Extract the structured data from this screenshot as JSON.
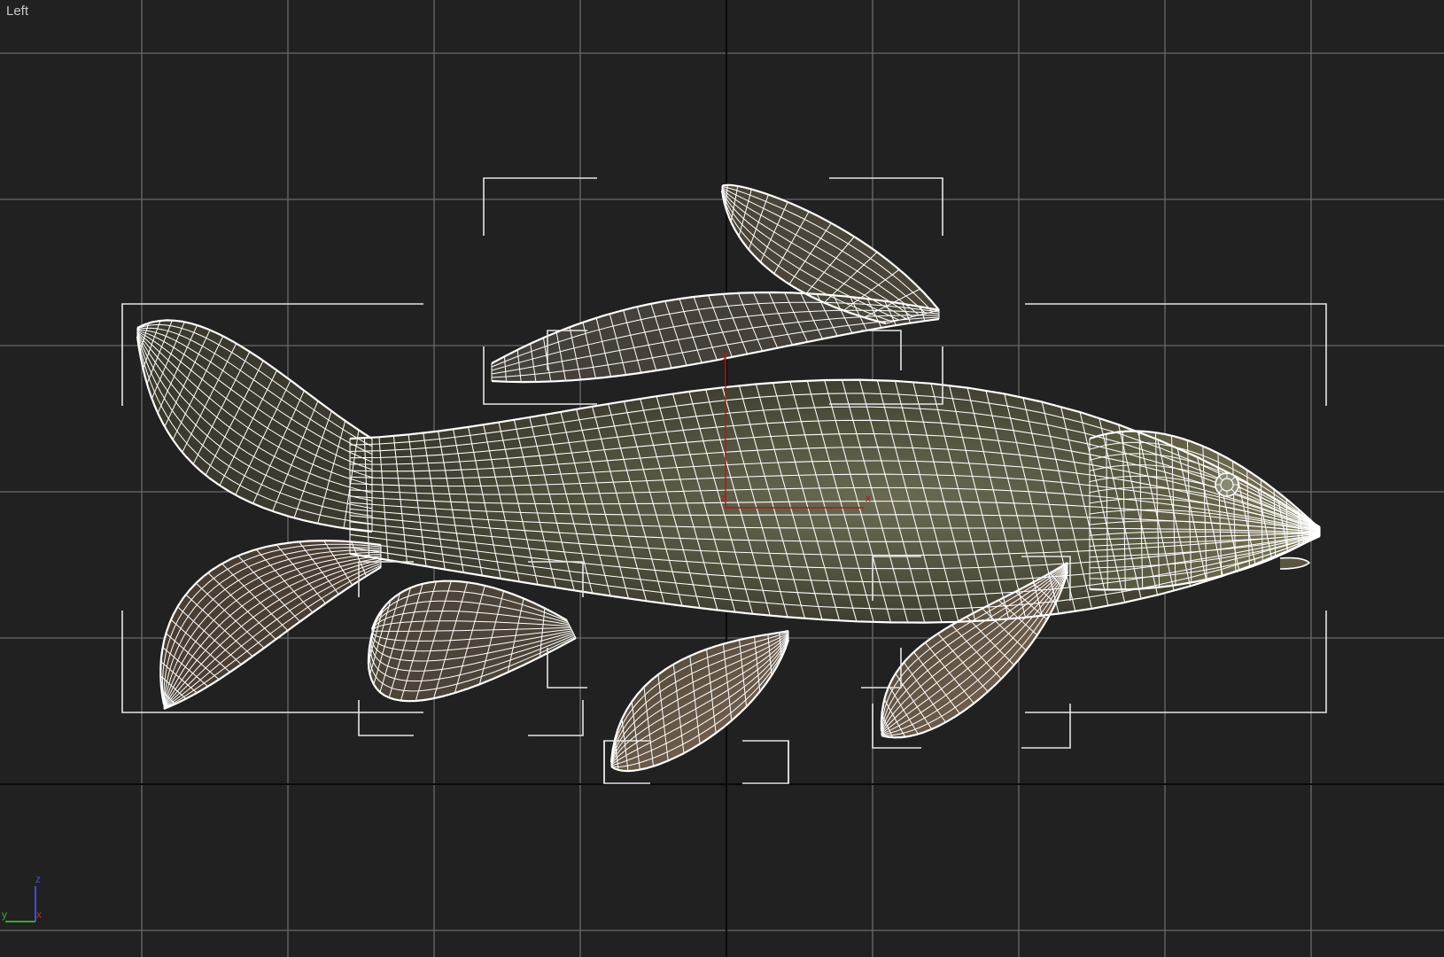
{
  "viewport": {
    "label": "Left",
    "object_name": "carp",
    "background_color": "#212121",
    "grid_color": "#6a6a6a",
    "world_axis_color": "#0a0a0a",
    "wire_color": "#ffffff",
    "bracket_color": "#e6e6e6",
    "pivot_color": "#b01818"
  },
  "pivot": {
    "x": "x",
    "y": "y",
    "z": "z"
  },
  "gizmo": {
    "x_label": "x",
    "y_label": "y",
    "z_label": "z",
    "x_color": "#c0302a",
    "y_color": "#3fa336",
    "z_color": "#3c4fd8"
  },
  "icons": [
    "axis-tripod-icon",
    "pivot-icon"
  ]
}
